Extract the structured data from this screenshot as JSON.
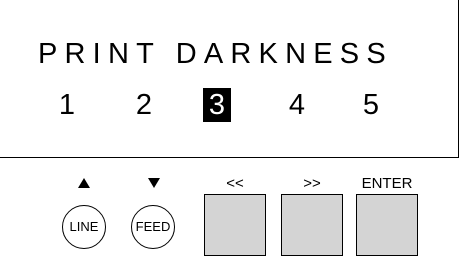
{
  "display": {
    "title": "PRINT DARKNESS",
    "options": [
      "1",
      "2",
      "3",
      "4",
      "5"
    ],
    "selected_option": "3"
  },
  "keypad": {
    "line": {
      "arrow_icon": "up-triangle-icon",
      "label": "LINE"
    },
    "feed": {
      "arrow_icon": "down-triangle-icon",
      "label": "FEED"
    },
    "prev": {
      "label": "<<"
    },
    "next": {
      "label": ">>"
    },
    "enter": {
      "label": "ENTER"
    }
  }
}
